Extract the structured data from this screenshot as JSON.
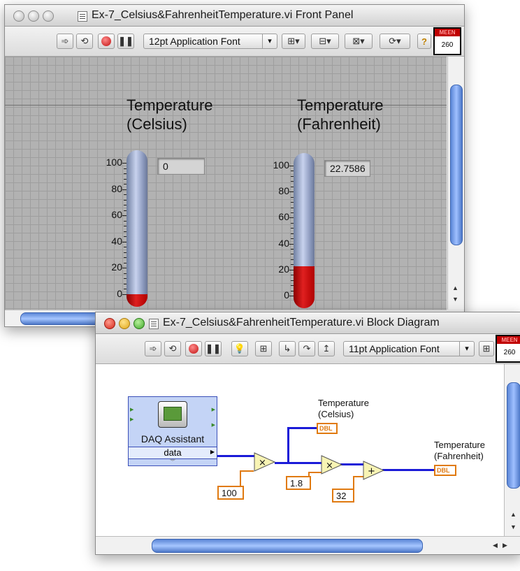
{
  "front_panel": {
    "title": "Ex-7_Celsius&FahrenheitTemperature.vi Front Panel",
    "font_selector": "12pt Application Font",
    "context_tag": "MEEN",
    "context_number": "260",
    "celsius": {
      "label_line1": "Temperature",
      "label_line2": "(Celsius)",
      "value": "0",
      "level": 0,
      "scale": [
        "100",
        "80",
        "60",
        "40",
        "20",
        "0"
      ]
    },
    "fahrenheit": {
      "label_line1": "Temperature",
      "label_line2": "(Fahrenheit)",
      "value": "22.7586",
      "level": 22.7586,
      "scale": [
        "100",
        "80",
        "60",
        "40",
        "20",
        "0"
      ]
    }
  },
  "block_diagram": {
    "title": "Ex-7_Celsius&FahrenheitTemperature.vi Block Diagram",
    "font_selector": "11pt Application Font",
    "context_tag": "MEEN",
    "context_number": "260",
    "daq_label": "DAQ Assistant",
    "daq_output": "data",
    "celsius_label_line1": "Temperature",
    "celsius_label_line2": "(Celsius)",
    "fahrenheit_label_line1": "Temperature",
    "fahrenheit_label_line2": "(Fahrenheit)",
    "terminal_type": "DBL",
    "const_100": "100",
    "const_1_8": "1.8",
    "const_32": "32",
    "multiply_symbol": "×",
    "add_symbol": "+"
  },
  "colors": {
    "thermometer_fill": "#d01818",
    "wire_numeric": "#1b1bd8",
    "terminal_orange": "#e07a10",
    "scrollbar_blue": "#6c95e0"
  }
}
